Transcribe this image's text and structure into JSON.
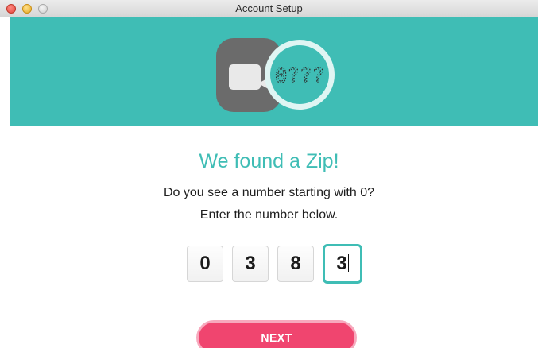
{
  "window": {
    "title": "Account Setup",
    "controls": [
      "close",
      "minimize",
      "zoom"
    ]
  },
  "banner": {
    "magnifier_text": "0???",
    "icons": [
      "card-icon",
      "magnifier-icon"
    ],
    "background_color": "#3fbdb5"
  },
  "content": {
    "heading": "We found a Zip!",
    "prompt_line1": "Do you see a number starting with 0?",
    "prompt_line2": "Enter the number below."
  },
  "zip_entry": {
    "digits": [
      "0",
      "3",
      "8",
      "3"
    ],
    "focused_index": 3
  },
  "actions": {
    "next_label": "NEXT",
    "next_color": "#f0456f"
  },
  "colors": {
    "accent": "#3fbdb5",
    "button": "#f0456f"
  }
}
